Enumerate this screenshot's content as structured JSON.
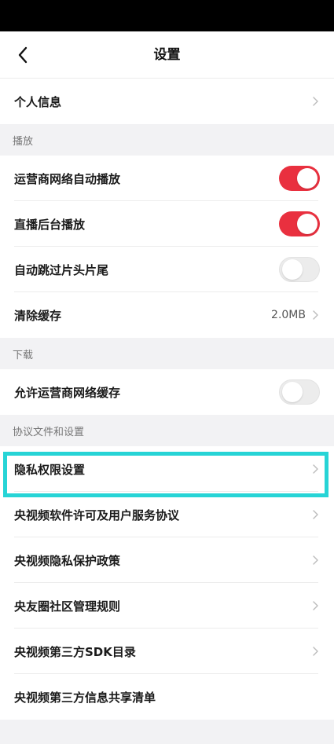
{
  "header": {
    "title": "设置",
    "back_icon": "chevron-left-icon"
  },
  "items": {
    "personal_info": "个人信息",
    "carrier_autoplay": "运营商网络自动播放",
    "live_background": "直播后台播放",
    "skip_intro": "自动跳过片头片尾",
    "clear_cache": "清除缓存",
    "cache_size": "2.0MB",
    "allow_carrier_cache": "允许运营商网络缓存",
    "privacy_settings": "隐私权限设置",
    "license_agreement": "央视频软件许可及用户服务协议",
    "privacy_policy": "央视频隐私保护政策",
    "community_rules": "央友圈社区管理规则",
    "sdk_list": "央视频第三方SDK目录",
    "info_sharing": "央视频第三方信息共享清单"
  },
  "sections": {
    "playback": "播放",
    "download": "下载",
    "agreements": "协议文件和设置"
  },
  "toggles": {
    "carrier_autoplay": true,
    "live_background": true,
    "skip_intro": false,
    "allow_carrier_cache": false
  },
  "colors": {
    "toggle_on": "#e9303f",
    "highlight_border": "#27d4d6"
  }
}
